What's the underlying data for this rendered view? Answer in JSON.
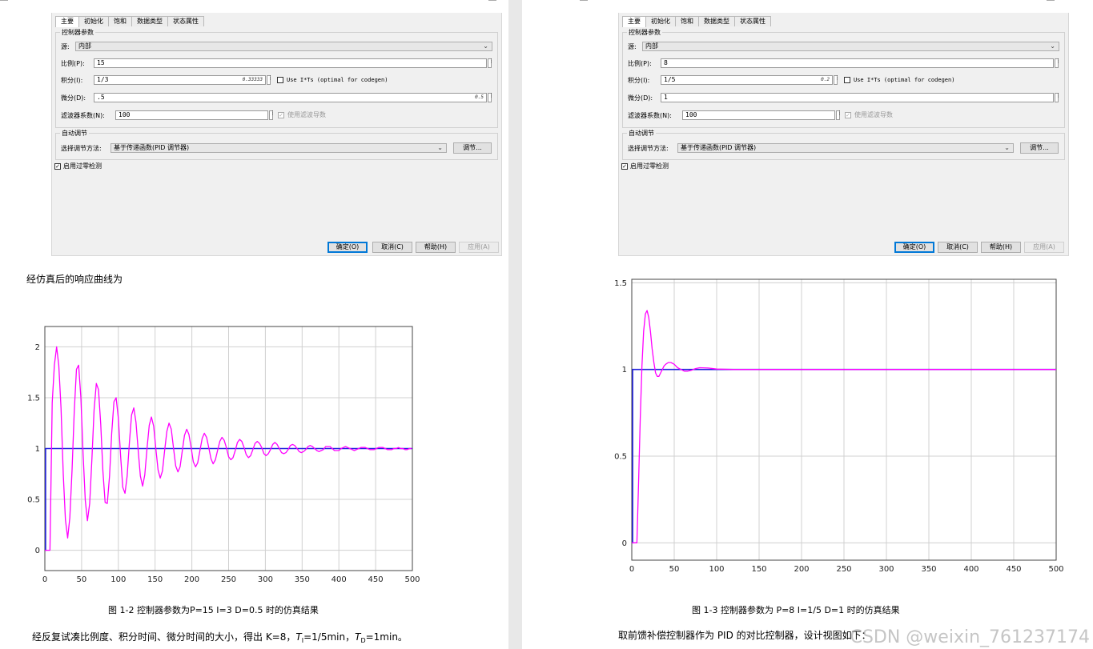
{
  "left": {
    "dialog": {
      "tabs": [
        "主要",
        "初始化",
        "饱和",
        "数据类型",
        "状态属性"
      ],
      "section_controller": "控制器参数",
      "source_label": "源:",
      "source_value": "内部",
      "p_label": "比例(P):",
      "p_value": "15",
      "i_label": "积分(I):",
      "i_value": "1/3",
      "i_hint": "0.33333",
      "use_its_label": "Use I*Ts (optimal for codegen)",
      "d_label": "微分(D):",
      "d_value": ".5",
      "d_hint": "0.5",
      "n_label": "滤波器系数(N):",
      "n_value": "100",
      "filter_label": "使用滤波导数",
      "section_auto": "自动调节",
      "method_label": "选择调节方法:",
      "method_value": "基于传递函数(PID 调节器)",
      "tune_button": "调节...",
      "zero_cross_label": "启用过零检测",
      "ok": "确定(O)",
      "cancel": "取消(C)",
      "help": "帮助(H)",
      "apply": "应用(A)"
    },
    "intro_text": "经仿真后的响应曲线为",
    "caption": "图 1-2 控制器参数为P=15    I=3    D=0.5 时的仿真结果",
    "bottom_text_prefix": "经反复试凑比例度、积分时间、微分时间的大小，得出 K=8，",
    "bottom_t": "T",
    "bottom_ti_sub": "I",
    "bottom_ti_value": "=1/5min，",
    "bottom_td_sub": "D",
    "bottom_td_value": "=1min。"
  },
  "right": {
    "dialog": {
      "tabs": [
        "主要",
        "初始化",
        "饱和",
        "数据类型",
        "状态属性"
      ],
      "section_controller": "控制器参数",
      "source_label": "源:",
      "source_value": "内部",
      "p_label": "比例(P):",
      "p_value": "8",
      "i_label": "积分(I):",
      "i_value": "1/5",
      "i_hint": "0.2",
      "use_its_label": "Use I*Ts (optimal for codegen)",
      "d_label": "微分(D):",
      "d_value": "1",
      "n_label": "滤波器系数(N):",
      "n_value": "100",
      "filter_label": "使用滤波导数",
      "section_auto": "自动调节",
      "method_label": "选择调节方法:",
      "method_value": "基于传递函数(PID 调节器)",
      "tune_button": "调节...",
      "zero_cross_label": "启用过零检测",
      "ok": "确定(O)",
      "cancel": "取消(C)",
      "help": "帮助(H)",
      "apply": "应用(A)"
    },
    "caption": "图 1-3 控制器参数为 P=8     I=1/5    D=1 时的仿真结果",
    "bottom_text": "取前馈补偿控制器作为 PID 的对比控制器，设计视图如下："
  },
  "watermark": "CSDN @weixin_761237174",
  "colors": {
    "response": "#ff00ff",
    "setpoint": "#2222dd",
    "grid": "#d0d0d0",
    "default_button": "#0078d7"
  },
  "chart_data": [
    {
      "type": "line",
      "title": "",
      "xlabel": "",
      "ylabel": "",
      "xlim": [
        0,
        500
      ],
      "ylim": [
        -0.2,
        2.2
      ],
      "xticks": [
        0,
        50,
        100,
        150,
        200,
        250,
        300,
        350,
        400,
        450,
        500
      ],
      "yticks": [
        0,
        0.5,
        1,
        1.5,
        2
      ],
      "grid": true,
      "series": [
        {
          "style": "step",
          "color": "#2222dd",
          "step_time": 1,
          "initial": 0,
          "final": 1
        },
        {
          "style": "line",
          "color": "#ff00ff",
          "x": [
            0,
            3,
            7,
            10,
            13,
            16,
            19,
            22,
            25,
            28,
            31,
            34,
            37,
            40,
            43,
            46,
            49,
            52,
            55,
            58,
            61,
            64,
            67,
            70,
            73,
            76,
            79,
            82,
            85,
            88,
            91,
            94,
            97,
            100,
            103,
            106,
            109,
            112,
            115,
            118,
            121,
            124,
            127,
            130,
            133,
            136,
            139,
            142,
            145,
            148,
            151,
            154,
            157,
            160,
            163,
            166,
            169,
            172,
            175,
            178,
            181,
            184,
            187,
            190,
            193,
            196,
            199,
            202,
            205,
            208,
            211,
            214,
            217,
            220,
            223,
            226,
            229,
            232,
            235,
            238,
            241,
            244,
            247,
            250,
            253,
            256,
            259,
            262,
            265,
            268,
            271,
            274,
            277,
            280,
            283,
            286,
            289,
            292,
            295,
            298,
            301,
            304,
            307,
            310,
            313,
            316,
            319,
            322,
            325,
            328,
            331,
            334,
            337,
            340,
            343,
            346,
            349,
            352,
            355,
            358,
            361,
            364,
            367,
            370,
            373,
            376,
            379,
            382,
            385,
            388,
            391,
            394,
            397,
            400,
            403,
            406,
            409,
            412,
            415,
            418,
            421,
            424,
            427,
            430,
            433,
            436,
            439,
            442,
            445,
            448,
            451,
            454,
            457,
            460,
            463,
            466,
            469,
            472,
            475,
            478,
            481,
            484,
            487,
            490,
            493,
            496,
            499
          ],
          "y": [
            0,
            0,
            0.0,
            1.45,
            1.82,
            2.0,
            1.82,
            1.4,
            0.75,
            0.3,
            0.12,
            0.32,
            0.79,
            1.36,
            1.78,
            1.82,
            1.5,
            0.96,
            0.49,
            0.29,
            0.46,
            0.9,
            1.38,
            1.64,
            1.58,
            1.24,
            0.78,
            0.47,
            0.46,
            0.73,
            1.15,
            1.46,
            1.5,
            1.3,
            0.93,
            0.62,
            0.56,
            0.73,
            1.06,
            1.33,
            1.4,
            1.26,
            0.98,
            0.73,
            0.63,
            0.74,
            1.0,
            1.23,
            1.31,
            1.22,
            1.0,
            0.79,
            0.71,
            0.78,
            0.98,
            1.17,
            1.25,
            1.19,
            1.01,
            0.83,
            0.77,
            0.82,
            0.98,
            1.13,
            1.19,
            1.14,
            1.01,
            0.87,
            0.82,
            0.86,
            0.98,
            1.1,
            1.15,
            1.11,
            1.01,
            0.9,
            0.85,
            0.89,
            0.98,
            1.07,
            1.11,
            1.08,
            1.01,
            0.92,
            0.89,
            0.91,
            0.98,
            1.06,
            1.09,
            1.07,
            1.01,
            0.94,
            0.91,
            0.93,
            0.99,
            1.05,
            1.07,
            1.05,
            1.01,
            0.95,
            0.93,
            0.95,
            0.99,
            1.04,
            1.06,
            1.04,
            1.0,
            0.96,
            0.95,
            0.96,
            0.99,
            1.03,
            1.04,
            1.03,
            1.0,
            0.97,
            0.96,
            0.97,
            0.99,
            1.02,
            1.03,
            1.02,
            1.0,
            0.98,
            0.97,
            0.98,
            0.99,
            1.02,
            1.02,
            1.02,
            1.0,
            0.98,
            0.98,
            0.98,
            1.0,
            1.01,
            1.02,
            1.01,
            1.0,
            0.99,
            0.98,
            0.99,
            1.0,
            1.01,
            1.01,
            1.01,
            1.0,
            0.99,
            0.99,
            0.99,
            1.0,
            1.01,
            1.01,
            1.01,
            1.0,
            0.99,
            0.99,
            0.99,
            1.0,
            1.0,
            1.01,
            1.0,
            1.0,
            0.99,
            0.99,
            1.0,
            1.0
          ]
        }
      ]
    },
    {
      "type": "line",
      "title": "",
      "xlabel": "",
      "ylabel": "",
      "xlim": [
        0,
        500
      ],
      "ylim": [
        -0.1,
        1.52
      ],
      "xticks": [
        0,
        50,
        100,
        150,
        200,
        250,
        300,
        350,
        400,
        450,
        500
      ],
      "yticks": [
        0,
        0.5,
        1,
        1.5
      ],
      "grid": true,
      "series": [
        {
          "style": "step",
          "color": "#2222dd",
          "step_time": 1,
          "initial": 0,
          "final": 1
        },
        {
          "style": "line",
          "color": "#ff00ff",
          "x": [
            0,
            3,
            6,
            8,
            10,
            12,
            14,
            16,
            18,
            20,
            22,
            24,
            26,
            28,
            30,
            32,
            34,
            36,
            38,
            40,
            43,
            46,
            50,
            54,
            58,
            62,
            66,
            70,
            75,
            80,
            90,
            100,
            120,
            150,
            200,
            300,
            400,
            500
          ],
          "y": [
            0,
            0,
            0,
            0.35,
            0.72,
            1.02,
            1.22,
            1.32,
            1.34,
            1.3,
            1.22,
            1.12,
            1.04,
            0.98,
            0.96,
            0.96,
            0.98,
            1.0,
            1.02,
            1.03,
            1.04,
            1.04,
            1.03,
            1.01,
            1.0,
            0.99,
            0.99,
            0.995,
            1.005,
            1.01,
            1.008,
            1.002,
            1.0,
            1.0,
            1.0,
            1.0,
            1.0,
            1.0
          ]
        }
      ]
    }
  ]
}
